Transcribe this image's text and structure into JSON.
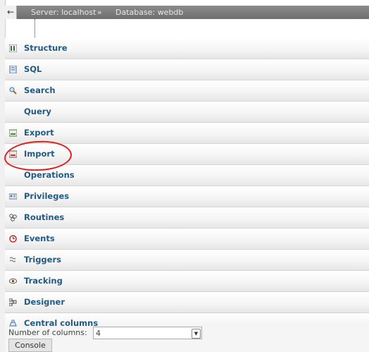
{
  "breadcrumb": {
    "back_glyph": "←",
    "server": "Server: localhost",
    "separator": "»",
    "database": "Database: webdb"
  },
  "menu": {
    "items": [
      {
        "label": "Structure",
        "icon": "structure-icon"
      },
      {
        "label": "SQL",
        "icon": "sql-icon"
      },
      {
        "label": "Search",
        "icon": "search-icon"
      },
      {
        "label": "Query",
        "icon": ""
      },
      {
        "label": "Export",
        "icon": "export-icon"
      },
      {
        "label": "Import",
        "icon": "import-icon"
      },
      {
        "label": "Operations",
        "icon": ""
      },
      {
        "label": "Privileges",
        "icon": "privileges-icon"
      },
      {
        "label": "Routines",
        "icon": "routines-icon"
      },
      {
        "label": "Events",
        "icon": "events-icon"
      },
      {
        "label": "Triggers",
        "icon": "triggers-icon"
      },
      {
        "label": "Tracking",
        "icon": "tracking-icon"
      },
      {
        "label": "Designer",
        "icon": "designer-icon"
      },
      {
        "label": "Central columns",
        "icon": "central-columns-icon"
      }
    ],
    "highlighted_item": "Import",
    "highlight_color": "#e0201b"
  },
  "form": {
    "columns_label": "Number of columns:",
    "columns_value": "4"
  },
  "console": {
    "label": "Console"
  }
}
